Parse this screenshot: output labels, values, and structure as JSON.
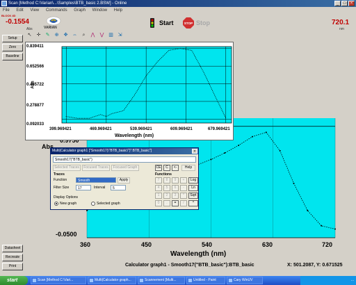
{
  "window": {
    "title": "Scan [Method C:\\Varian\\...\\Samples\\BTB_basic 2.BSW] - Online",
    "minimize_label": "_",
    "maximize_label": "□",
    "close_label": "×"
  },
  "menu": [
    "File",
    "Edit",
    "View",
    "Commands",
    "Graph",
    "Window",
    "Help"
  ],
  "readouts": {
    "abs_value": "-0.1554",
    "abs_label": "Abs",
    "wavelength_value": "720.1",
    "wavelength_unit": "nm",
    "top_small_label": "BLOCK 4D"
  },
  "brand": "VARIAN",
  "controls": {
    "start_label": "Start",
    "stop_label": "Stop",
    "stop_sign_text": "STOP"
  },
  "left_buttons": {
    "top": [
      "Setup",
      "Zero",
      "Baseline"
    ],
    "bottom": [
      "Datasheet",
      "Recreate",
      "Print"
    ]
  },
  "toolbar_icons": [
    "pointer-icon",
    "crosshair-icon",
    "pencil-icon",
    "zoom-icon",
    "move-icon",
    "stretch-icon",
    "magnify-icon",
    "peak-icon",
    "wavelength-icon",
    "scale-icon",
    "export-icon"
  ],
  "inset_chart": {
    "ylabel": "Abs",
    "xlabel": "Wavelength (nm)",
    "y_ticks": [
      "0.839411",
      "0.652566",
      "0.465722",
      "0.278877",
      "0.092033"
    ],
    "x_ticks": [
      "399.969421",
      "469.969421",
      "539.969421",
      "609.969421",
      "679.969421"
    ]
  },
  "chart_data": {
    "type": "line",
    "xlabel": "Wavelength (nm)",
    "ylabel": "Abs",
    "x_ticks": [
      "360",
      "450",
      "540",
      "630",
      "720"
    ],
    "y_ticks": [
      "0.9750",
      "-0.0500"
    ],
    "xlim": [
      360,
      720
    ],
    "ylim": [
      -0.05,
      1.05
    ],
    "series": [
      {
        "name": "",
        "color": "#000000",
        "x": [
          360,
          380,
          400,
          420,
          440,
          460,
          480,
          500,
          520,
          540,
          560,
          580,
          600,
          620,
          640,
          660,
          680,
          700,
          720
        ],
        "y": [
          0.2,
          0.26,
          0.3,
          0.35,
          0.4,
          0.45,
          0.52,
          0.58,
          0.62,
          0.67,
          0.73,
          0.8,
          0.88,
          0.92,
          0.75,
          0.45,
          0.2,
          0.06,
          0.03
        ]
      }
    ]
  },
  "calc_dialog": {
    "title": "Multi|Calculator graph1 [\"Smooth17(\\\"BTB_basic\\\")\":BTB_basic\"]",
    "close_label": "×",
    "expression": "Smooth17(\"BTB_basic\")",
    "selected_trace_btn": "Selected Traces",
    "focused_trace_btn": "Focused Traces",
    "focused_graph_btn": "Focused Graph",
    "ce_btn": "CE",
    "c_btn": "C",
    "backspace_btn": "<-",
    "help_btn": "Help",
    "traces_label": "Traces",
    "functions_label": "Functions",
    "function_label": "Function",
    "function_value": "Smooth",
    "apply_btn": "Apply",
    "filter_size_label": "Filter Size",
    "filter_size_value": "17",
    "interval_label": "Interval",
    "interval_value": "5",
    "display_options_label": "Display Options",
    "new_graph_label": "New graph",
    "selected_graph_label": "Selected graph",
    "keys": [
      "7",
      "8",
      "9",
      "+",
      "Log",
      "4",
      "5",
      "6",
      "-",
      "Ln",
      "1",
      "2",
      "3",
      "*",
      "Sqrt",
      "0",
      ".",
      "=",
      "/",
      "^"
    ]
  },
  "status_line": {
    "trace": "Calculator graph1 - Smooth17(\"BTB_basic\"):BTB_basic",
    "coords": "X: 501.2087, Y: 0.671525"
  },
  "taskbar": {
    "start_label": "start",
    "items": [
      "Scan [Method C:\\Vari...",
      "Multi|Calculator graph...",
      "Scannement [Multi...",
      "Untitled - Paint",
      "Cary WinUV"
    ],
    "clock": "..."
  }
}
